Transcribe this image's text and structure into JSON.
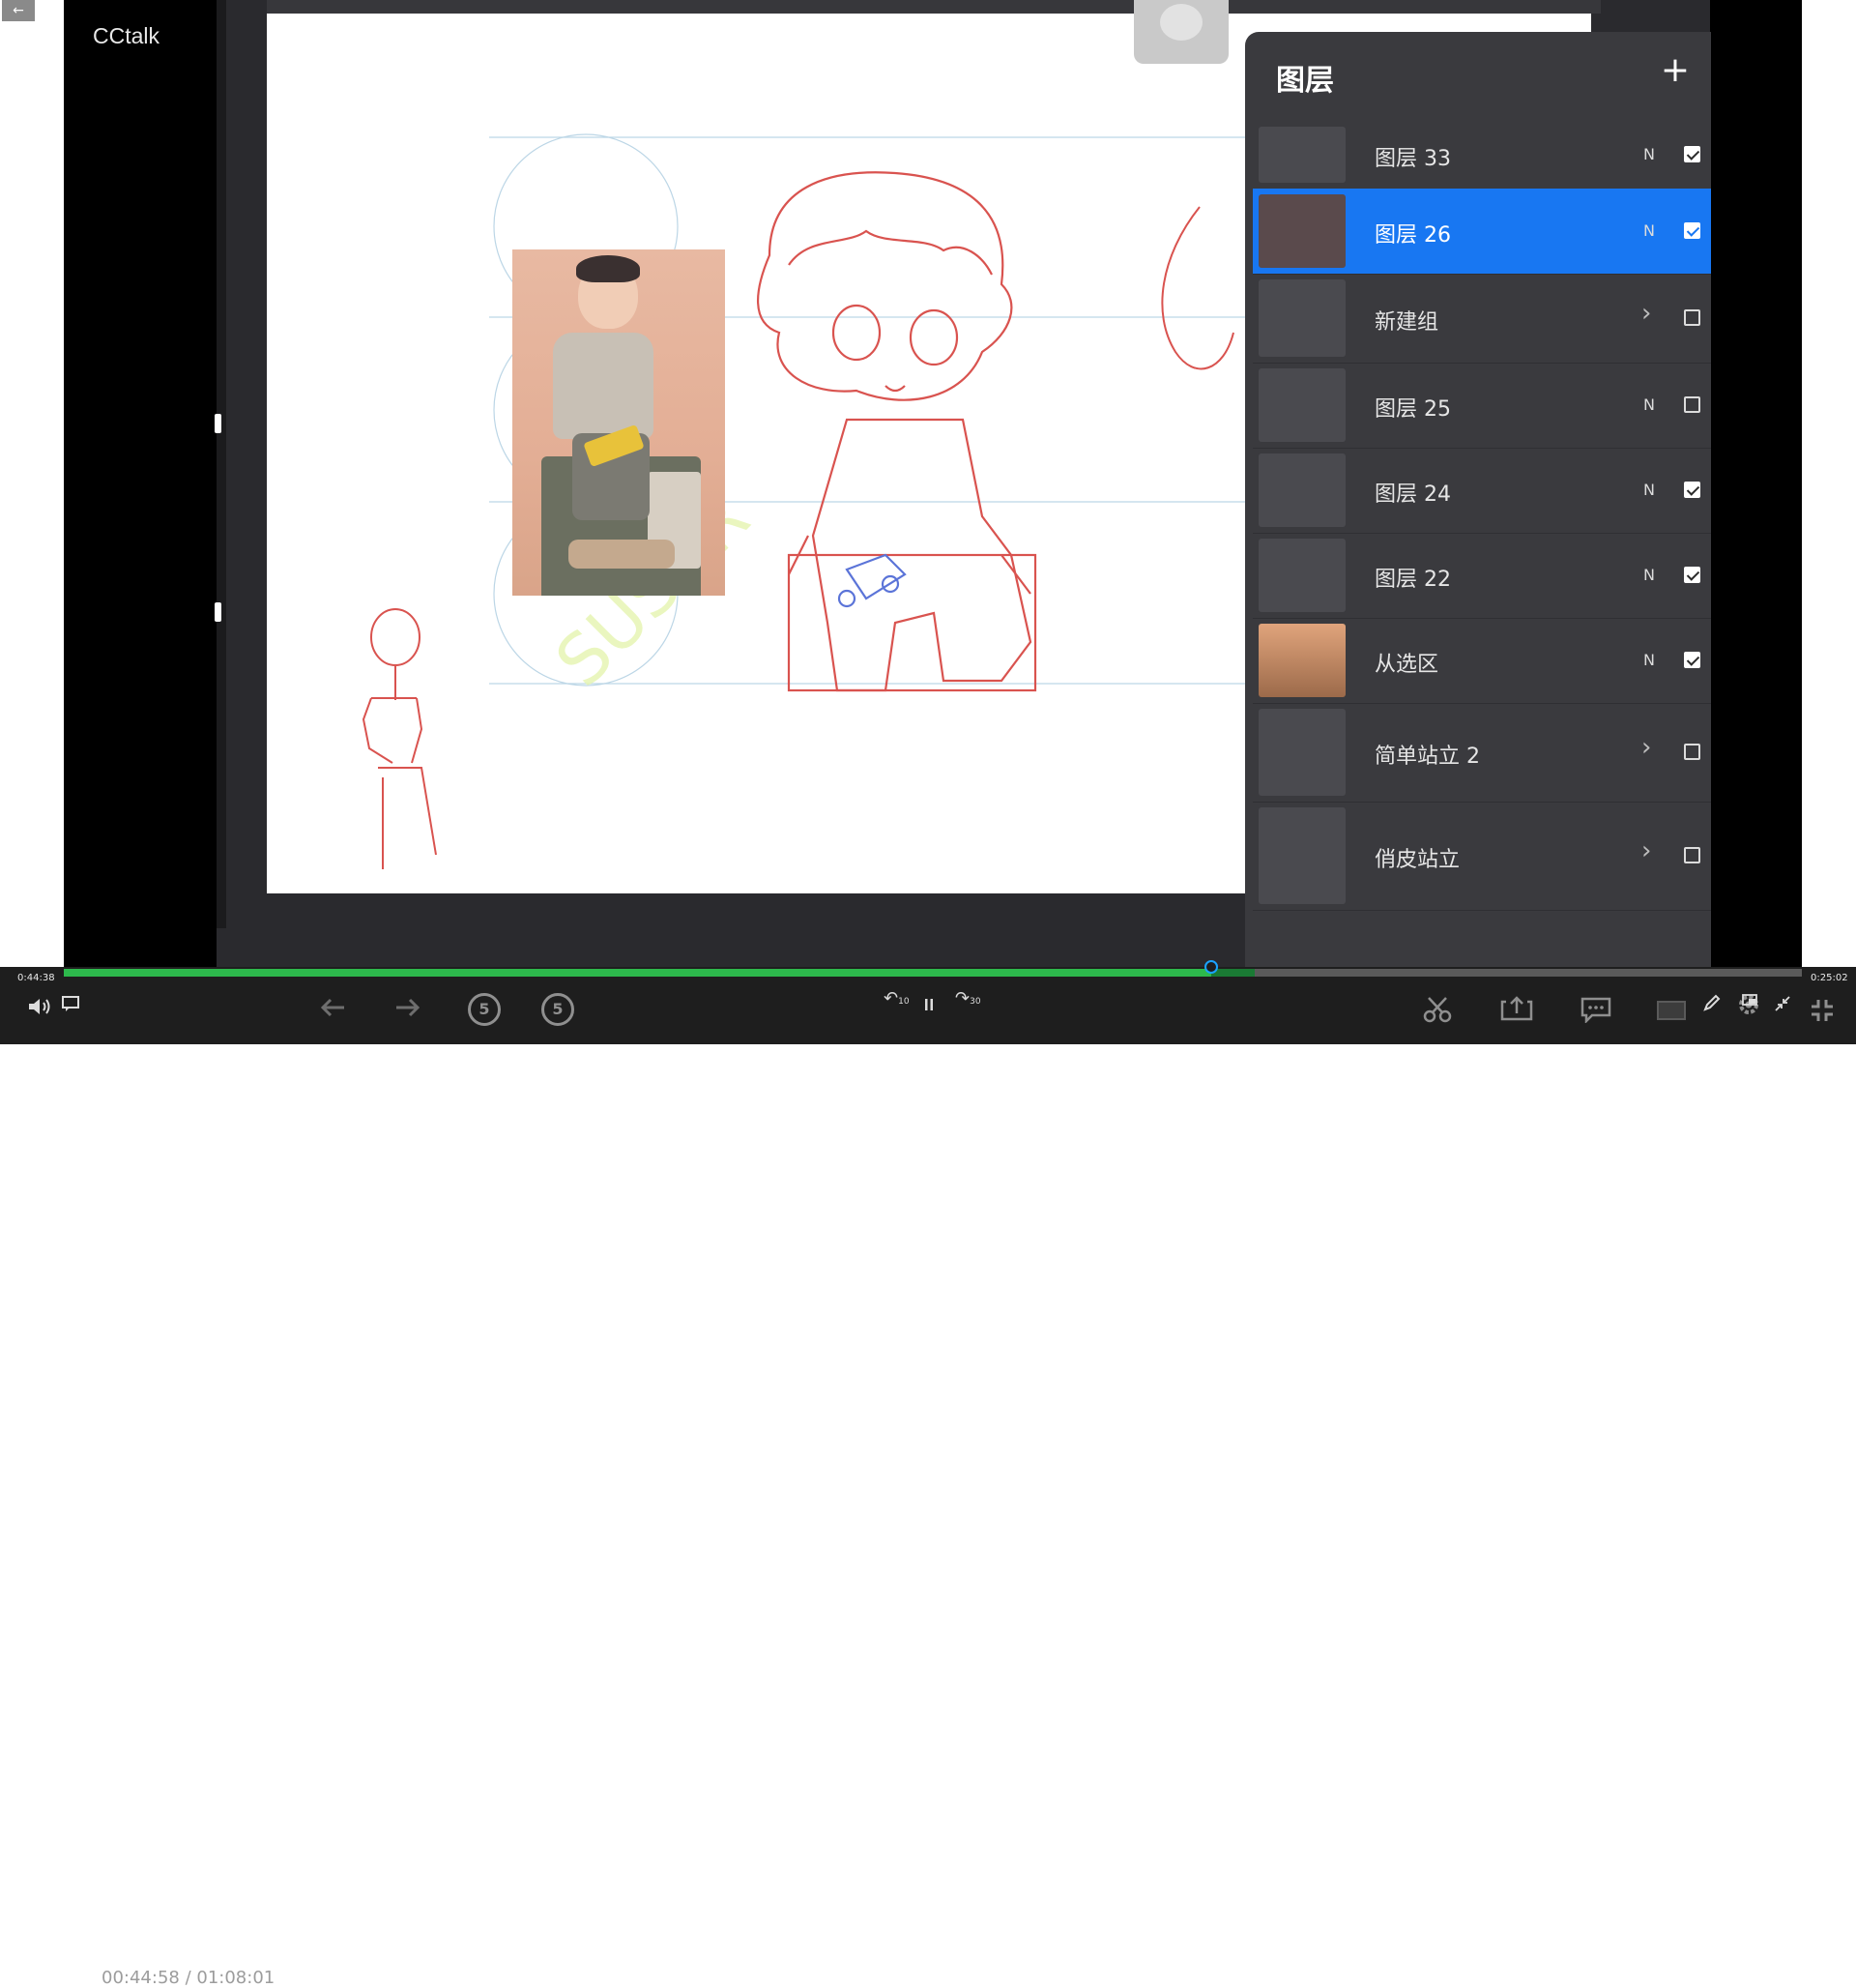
{
  "player": {
    "back_icon": "←",
    "brand": "CCtalk",
    "current_time": "00:44:58",
    "separator": "/",
    "duration": "01:08:01",
    "progress_start_label": "0:44:38",
    "progress_end_label": "0:25:02",
    "progress_fraction": 0.66,
    "buffered_fraction": 0.685
  },
  "canvas": {
    "watermark": "SUSCR"
  },
  "layers_panel": {
    "title": "图层",
    "add_icon": "+",
    "rows": [
      {
        "name": "图层 33",
        "mode": "N",
        "checked": true,
        "group": false,
        "active": false
      },
      {
        "name": "图层 26",
        "mode": "N",
        "checked": true,
        "group": false,
        "active": true
      },
      {
        "name": "新建组",
        "mode": "",
        "checked": false,
        "group": true,
        "active": false
      },
      {
        "name": "图层 25",
        "mode": "N",
        "checked": false,
        "group": false,
        "active": false
      },
      {
        "name": "图层 24",
        "mode": "N",
        "checked": true,
        "group": false,
        "active": false
      },
      {
        "name": "图层 22",
        "mode": "N",
        "checked": true,
        "group": false,
        "active": false
      },
      {
        "name": "从选区",
        "mode": "N",
        "checked": true,
        "group": false,
        "active": false
      },
      {
        "name": "简单站立 2",
        "mode": "",
        "checked": false,
        "group": true,
        "active": false
      },
      {
        "name": "俏皮站立",
        "mode": "",
        "checked": false,
        "group": true,
        "active": false
      }
    ]
  },
  "controls": {
    "skip_back_label": "5",
    "skip_fwd_label": "5",
    "rewind10_label": "10",
    "forward30_label": "30",
    "icons": [
      "volume-icon",
      "danmaku-icon",
      "prev-icon",
      "next-icon",
      "rewind-5-icon",
      "forward-5-icon",
      "rewind-10-icon",
      "pause-icon",
      "forward-30-icon",
      "scissors-icon",
      "share-icon",
      "comment-icon",
      "screen-icon",
      "pen-icon",
      "settings-icon",
      "pip-icon",
      "shrink-icon",
      "fullscreen-exit-icon"
    ]
  },
  "colors": {
    "active_layer": "#1877f2",
    "progress_played": "#2db84c",
    "sketch_red": "#d9534f",
    "sketch_blue": "#5b74d8"
  }
}
